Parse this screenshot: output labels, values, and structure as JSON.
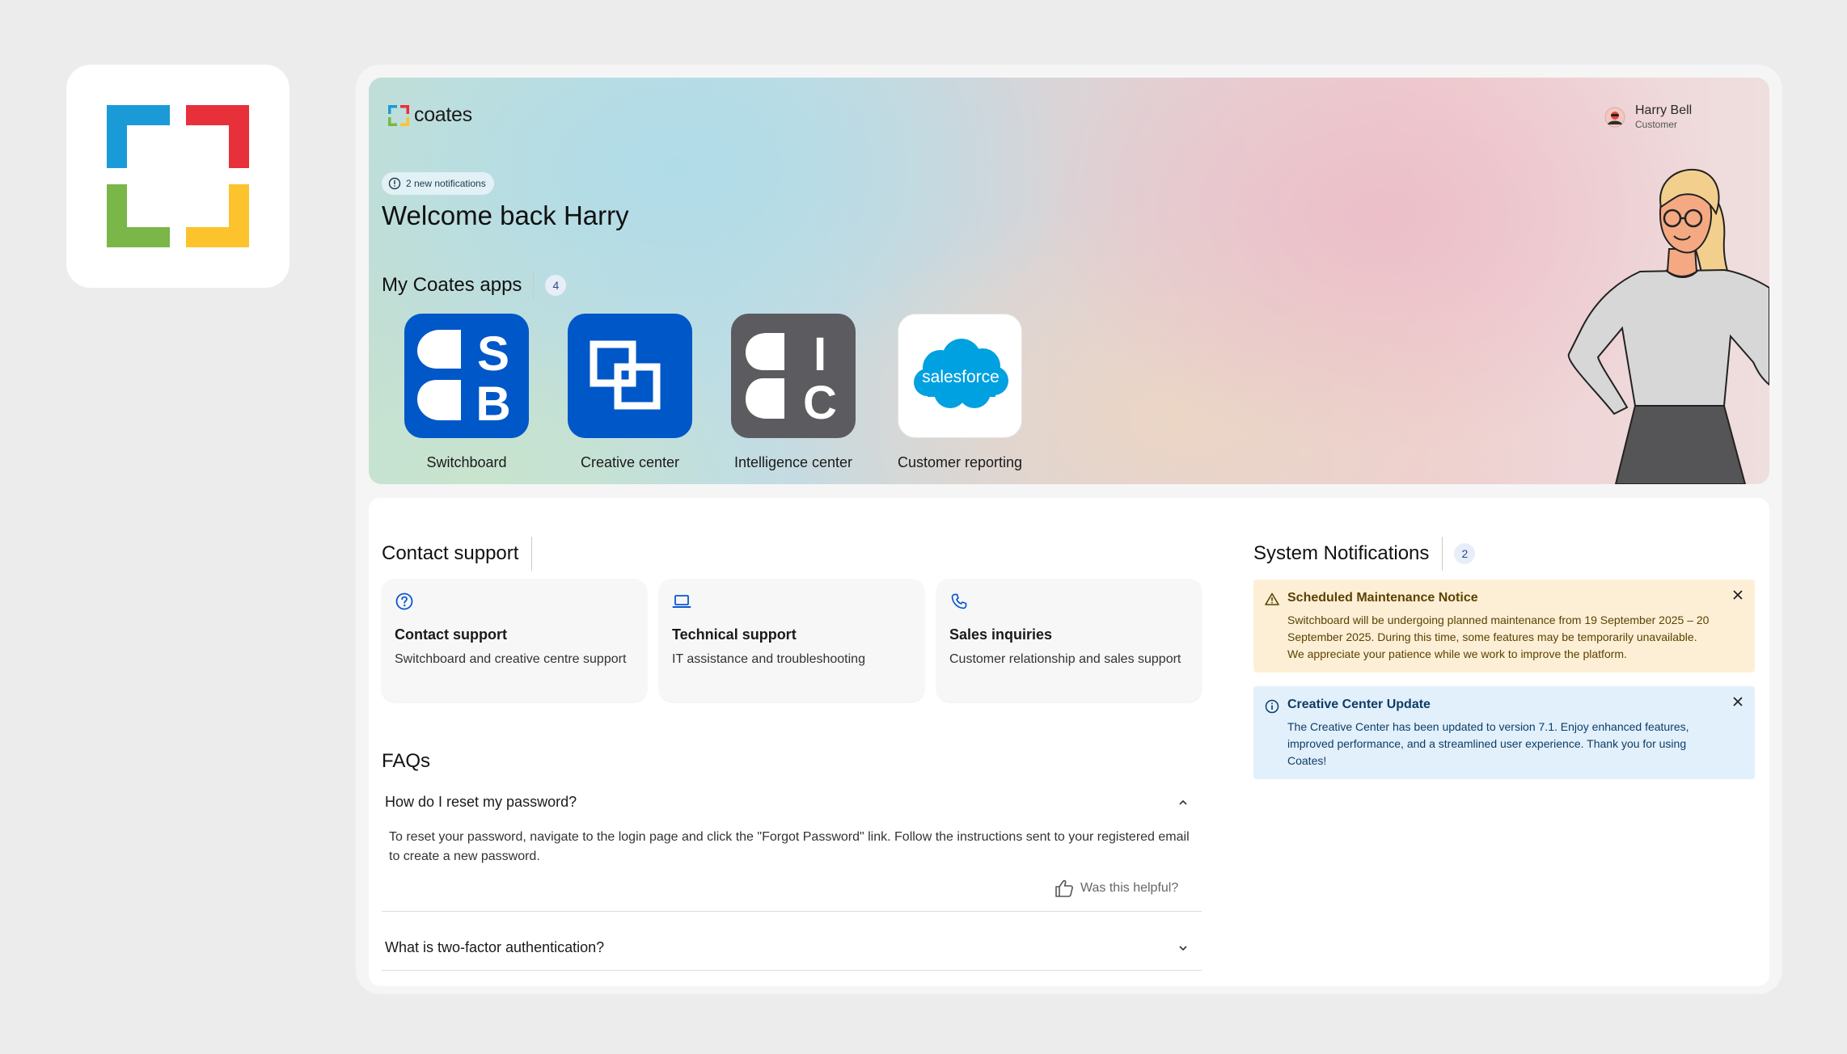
{
  "brand": {
    "name": "coates"
  },
  "user": {
    "name": "Harry Bell",
    "role": "Customer"
  },
  "hero": {
    "notifications_label": "2 new notifications",
    "welcome": "Welcome back Harry",
    "apps_title": "My Coates apps",
    "apps_count": "4"
  },
  "apps": [
    {
      "label": "Switchboard",
      "icon_text_1": "S",
      "icon_text_2": "B",
      "color": "#0057c8"
    },
    {
      "label": "Creative center",
      "color": "#0057c8"
    },
    {
      "label": "Intelligence center",
      "icon_text_1": "I",
      "icon_text_2": "C",
      "color": "#5c5c60"
    },
    {
      "label": "Customer reporting",
      "icon_text_1": "salesforce",
      "color": "#00a1e0"
    }
  ],
  "support": {
    "title": "Contact support",
    "cards": [
      {
        "title": "Contact support",
        "desc": "Switchboard and creative centre support",
        "icon": "question-circle-icon"
      },
      {
        "title": "Technical support",
        "desc": "IT assistance and troubleshooting",
        "icon": "laptop-icon"
      },
      {
        "title": "Sales inquiries",
        "desc": "Customer relationship and sales support",
        "icon": "phone-icon"
      }
    ]
  },
  "faqs": {
    "title": "FAQs",
    "items": [
      {
        "question": "How do I reset my password?",
        "answer": "To reset your password, navigate to the login page and click the \"Forgot Password\" link. Follow the instructions sent to your registered email to create a new password.",
        "helpful_label": "Was this helpful?",
        "expanded": true
      },
      {
        "question": "What is two-factor authentication?",
        "expanded": false
      }
    ]
  },
  "system_notifications": {
    "title": "System Notifications",
    "count": "2",
    "items": [
      {
        "title": "Scheduled Maintenance Notice",
        "body": "Switchboard will be undergoing planned maintenance from 19 September 2025 – 20 September 2025. During this time, some features may be temporarily unavailable. We appreciate your patience while we work to improve the platform.",
        "type": "warning",
        "bg": "#fdefd6",
        "color": "#5a4300"
      },
      {
        "title": "Creative Center Update",
        "body": "The Creative Center has been updated to version 7.1. Enjoy enhanced features, improved performance, and a streamlined user experience. Thank you for using Coates!",
        "type": "info",
        "bg": "#e2f0fb",
        "color": "#0d3d66"
      }
    ]
  }
}
